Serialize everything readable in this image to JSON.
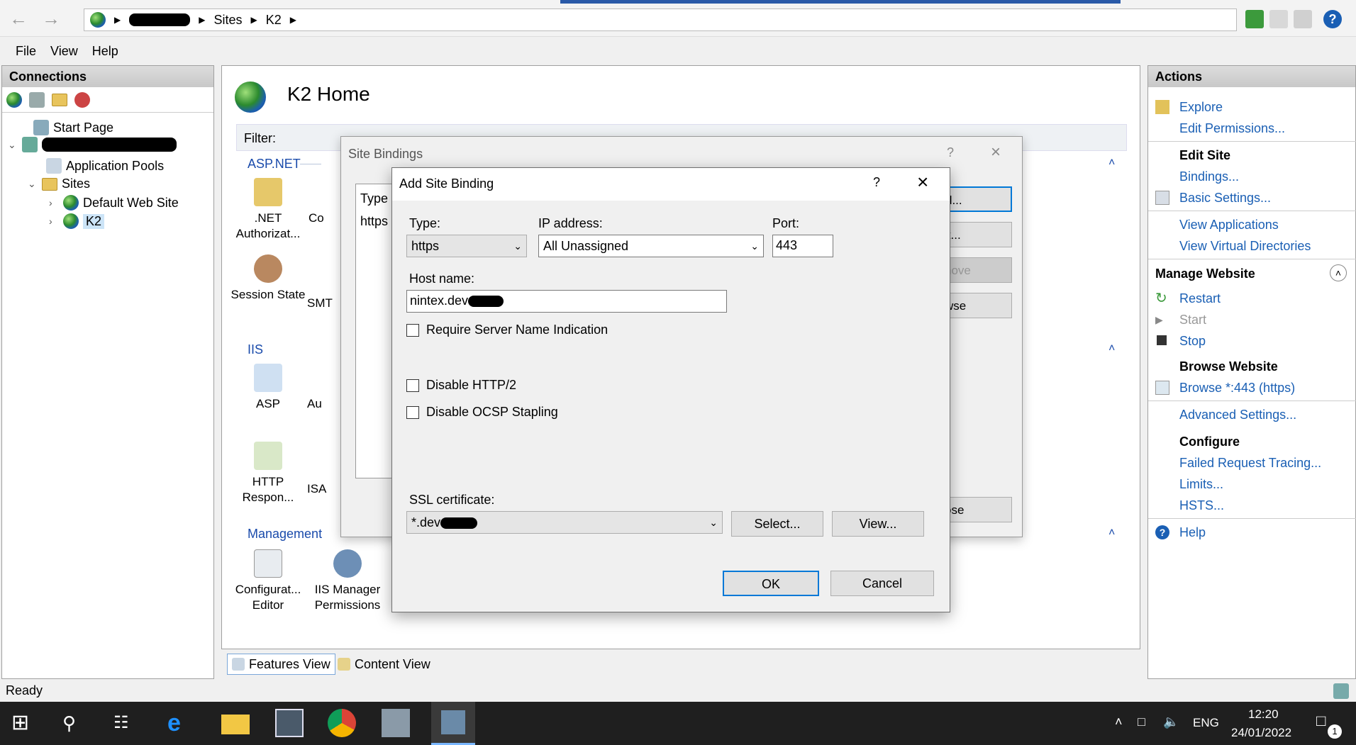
{
  "breadcrumb": {
    "sites": "Sites",
    "site": "K2"
  },
  "menu": {
    "file": "File",
    "view": "View",
    "help": "Help"
  },
  "connections": {
    "title": "Connections",
    "tree": {
      "start_page": "Start Page",
      "app_pools": "Application Pools",
      "sites": "Sites",
      "default_site": "Default Web Site",
      "k2": "K2"
    }
  },
  "center": {
    "title": "K2 Home",
    "filter_label": "Filter:",
    "groups": {
      "aspnet": "ASP.NET",
      "iis": "IIS",
      "management": "Management"
    },
    "features": {
      "net_auth_1": ".NET",
      "net_auth_2": "Authorizat...",
      "co": "Co",
      "session_state": "Session State",
      "smt": "SMT",
      "asp": "ASP",
      "au": "Au",
      "http_resp_1": "HTTP",
      "http_resp_2": "Respon...",
      "isa": "ISA",
      "config_1": "Configurat...",
      "config_2": "Editor",
      "iism_1": "IIS Manager",
      "iism_2": "Permissions"
    },
    "view_tabs": {
      "features": "Features View",
      "content": "Content View"
    }
  },
  "actions": {
    "title": "Actions",
    "explore": "Explore",
    "edit_permissions": "Edit Permissions...",
    "edit_site": "Edit Site",
    "bindings": "Bindings...",
    "basic_settings": "Basic Settings...",
    "view_applications": "View Applications",
    "view_vdirs": "View Virtual Directories",
    "manage_website": "Manage Website",
    "restart": "Restart",
    "start": "Start",
    "stop": "Stop",
    "browse_website": "Browse Website",
    "browse_443": "Browse *:443 (https)",
    "advanced_settings": "Advanced Settings...",
    "configure": "Configure",
    "failed_request": "Failed Request Tracing...",
    "limits": "Limits...",
    "hsts": "HSTS...",
    "help": "Help"
  },
  "status": {
    "text": "Ready"
  },
  "site_bindings": {
    "title": "Site Bindings",
    "help": "?",
    "col_type": "Type",
    "row_type": "https",
    "btn_add": "d...",
    "btn_edit": "it...",
    "btn_remove": "nove",
    "btn_browse": "wse",
    "btn_close": "ose"
  },
  "add_binding": {
    "title": "Add Site Binding",
    "help": "?",
    "type_label": "Type:",
    "type_value": "https",
    "ip_label": "IP address:",
    "ip_value": "All Unassigned",
    "port_label": "Port:",
    "port_value": "443",
    "host_label": "Host name:",
    "host_value": "nintex.dev",
    "sni": "Require Server Name Indication",
    "http2": "Disable HTTP/2",
    "ocsp": "Disable OCSP Stapling",
    "ssl_label": "SSL certificate:",
    "ssl_value": "*.dev",
    "select": "Select...",
    "view": "View...",
    "ok": "OK",
    "cancel": "Cancel"
  },
  "taskbar": {
    "lang": "ENG",
    "time": "12:20",
    "date": "24/01/2022",
    "notif_count": "1"
  }
}
